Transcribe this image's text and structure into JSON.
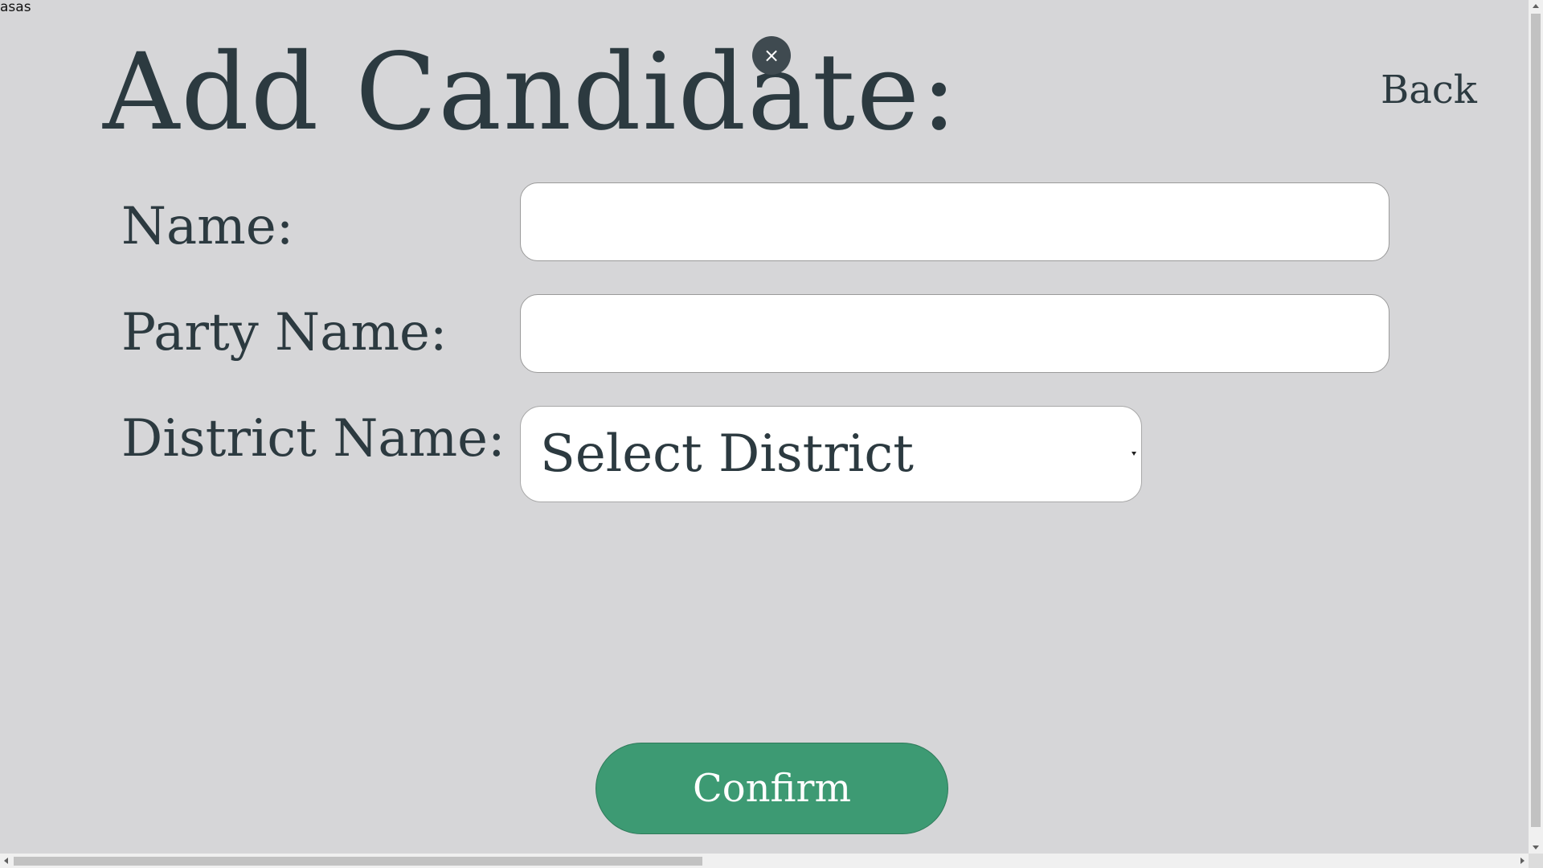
{
  "top_text": "asas",
  "header": {
    "title": "Add Candidate:",
    "close_icon": "close-icon",
    "close_glyph": "×",
    "back_label": "Back"
  },
  "form": {
    "name_label": "Name:",
    "name_value": "",
    "party_label": "Party Name:",
    "party_value": "",
    "district_label": "District Name:",
    "district_selected": "Select District"
  },
  "confirm_label": "Confirm",
  "colors": {
    "background": "#d6d6d8",
    "text": "#2c3a40",
    "confirm_button": "#3d9a73",
    "close_button": "#3f4a50"
  }
}
